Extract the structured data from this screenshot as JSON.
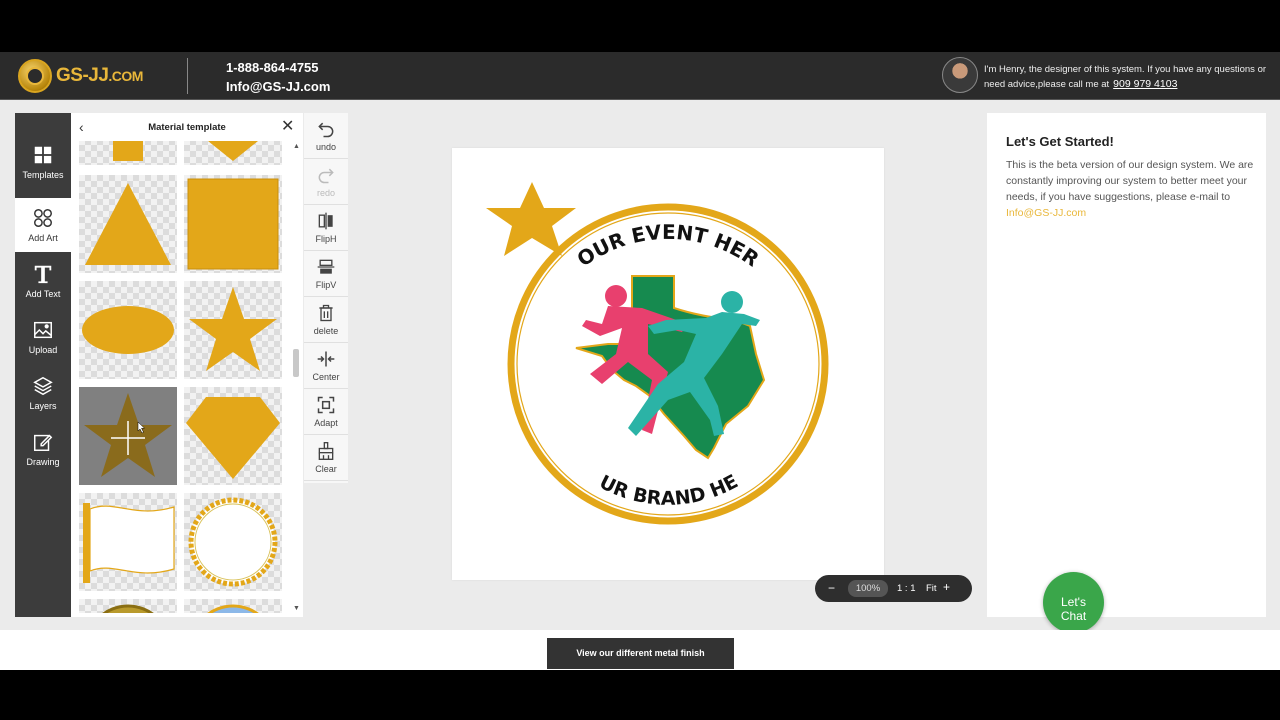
{
  "header": {
    "logo_text": "GS-JJ",
    "logo_suffix": ".COM",
    "phone": "1-888-864-4755",
    "email": "Info@GS-JJ.com",
    "designer_note": "I'm Henry, the designer of this system. If you have any questions or need advice,please call me at",
    "designer_phone": "909 979 4103"
  },
  "sidebar": {
    "items": [
      {
        "label": "Templates",
        "icon": "grid-icon"
      },
      {
        "label": "Add Art",
        "icon": "clover-icon"
      },
      {
        "label": "Add Text",
        "icon": "text-T-icon"
      },
      {
        "label": "Upload",
        "icon": "image-icon"
      },
      {
        "label": "Layers",
        "icon": "layers-icon"
      },
      {
        "label": "Drawing",
        "icon": "pencil-icon"
      }
    ],
    "active": "Add Art"
  },
  "panel": {
    "title": "Material template",
    "back_icon": "chevron-left-icon",
    "close_icon": "close-icon",
    "shapes": [
      "square",
      "diamond",
      "triangle",
      "square",
      "ellipse",
      "star",
      "star",
      "diamond",
      "banner",
      "chain-ring",
      "circle-gold",
      "circle-blue"
    ],
    "fill_color": "#E3A719"
  },
  "tools": [
    {
      "label": "undo",
      "icon": "undo-icon",
      "enabled": true
    },
    {
      "label": "redo",
      "icon": "redo-icon",
      "enabled": false
    },
    {
      "label": "FlipH",
      "icon": "flip-horizontal-icon",
      "enabled": true
    },
    {
      "label": "FlipV",
      "icon": "flip-vertical-icon",
      "enabled": true
    },
    {
      "label": "delete",
      "icon": "trash-icon",
      "enabled": true
    },
    {
      "label": "Center",
      "icon": "center-icon",
      "enabled": true
    },
    {
      "label": "Adapt",
      "icon": "adapt-icon",
      "enabled": true
    },
    {
      "label": "Clear",
      "icon": "clear-brush-icon",
      "enabled": true
    }
  ],
  "canvas": {
    "top_text": "YOUR EVENT HERE",
    "bottom_text": "YOUR BRAND HERE",
    "ring_color": "#E3A719",
    "texas_color": "#168A4F",
    "runner1_color": "#E8406E",
    "runner2_color": "#2BB3A6"
  },
  "zoom": {
    "minus": "−",
    "value": "100%",
    "ratio": "1 : 1",
    "fit": "Fit",
    "plus": "+"
  },
  "info": {
    "title": "Let's Get Started!",
    "body": "This is the beta version of our design system. We are constantly improving our system to better meet your needs, if you have suggestions, please e-mail to",
    "email": "Info@GS-JJ.com"
  },
  "chat": {
    "line1": "Let's",
    "line2": "Chat"
  },
  "footer": {
    "metal_button": "View our different metal finish"
  }
}
